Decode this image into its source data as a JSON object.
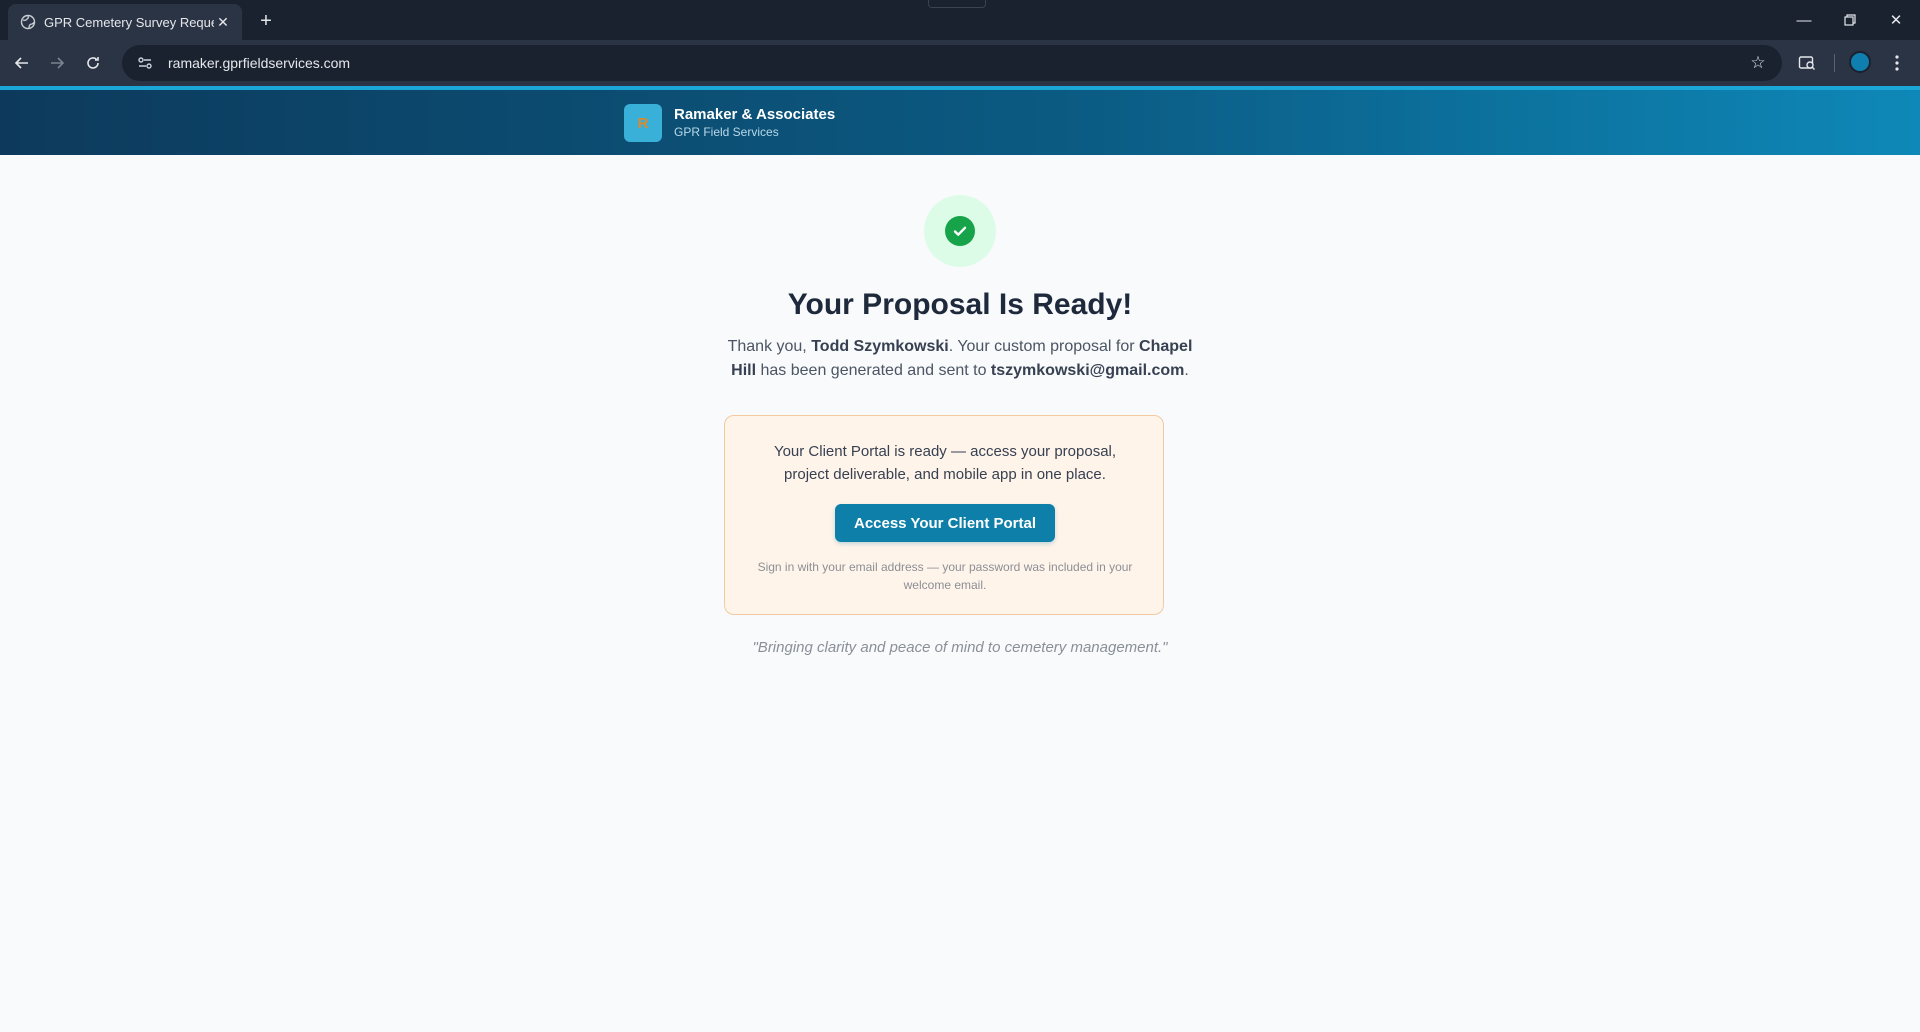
{
  "browser": {
    "tab_title": "GPR Cemetery Survey Request -",
    "url": "ramaker.gprfieldservices.com"
  },
  "site": {
    "logo_letter": "R",
    "brand_name": "Ramaker & Associates",
    "brand_sub": "GPR Field Services"
  },
  "confirmation": {
    "headline": "Your Proposal Is Ready!",
    "thanks_prefix": "Thank you, ",
    "client_name": "Todd Szymkowski",
    "thanks_mid": ". Your custom proposal for ",
    "location": "Chapel Hill",
    "thanks_mid2": " has been generated and sent to ",
    "email": "tszymkowski@gmail.com",
    "thanks_suffix": "."
  },
  "portal": {
    "text": "Your Client Portal is ready — access your proposal, project deliverable, and mobile app in one place.",
    "button_label": "Access Your Client Portal",
    "note": "Sign in with your email address — your password was included in your welcome email."
  },
  "tagline": "\"Bringing clarity and peace of mind to cemetery management.\"",
  "colors": {
    "header_start": "#0d3a5c",
    "header_end": "#0e88b8",
    "accent": "#0e7fa8",
    "success": "#16a34a"
  }
}
